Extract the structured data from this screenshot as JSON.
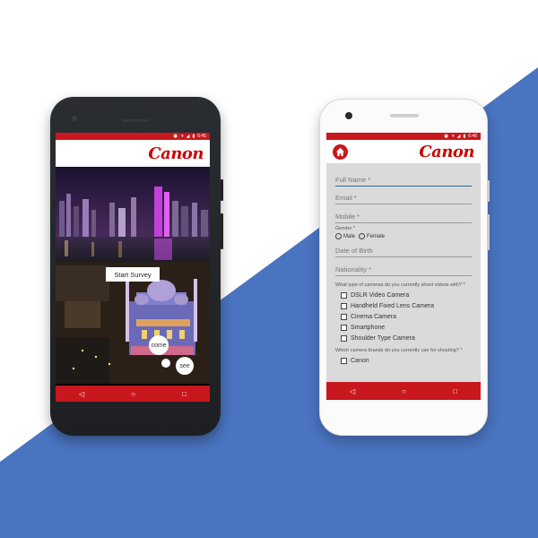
{
  "colors": {
    "brand_red": "#c8171d",
    "background_blue": "#4a74c0",
    "canon_red": "#cc0000"
  },
  "left_phone": {
    "status_time": "6:45",
    "logo": "Canon",
    "start_button": "Start Survey",
    "bubbles": {
      "come": "come",
      "see": "see"
    },
    "nav": {
      "back": "◁",
      "home": "○",
      "recents": "□"
    }
  },
  "right_phone": {
    "status_time": "6:46",
    "logo": "Canon",
    "home_icon": "home-icon",
    "fields": {
      "full_name": "Full Name *",
      "email": "Email *",
      "mobile": "Mobile *",
      "date_of_birth": "Date of Birth",
      "nationality": "Nationality *"
    },
    "gender": {
      "label": "Gender *",
      "options": [
        "Male",
        "Female"
      ]
    },
    "question_cameras": "What type of cameras do you currently shoot videos with? *",
    "camera_types": [
      "DSLR Video Camera",
      "Handheld Fixed Lens Camera",
      "Cinema Camera",
      "Smartphone",
      "Shoulder Type Camera"
    ],
    "question_brands": "Which camera brands do you currently use for shooting? *",
    "brands": [
      "Canon"
    ],
    "nav": {
      "back": "◁",
      "home": "○",
      "recents": "□"
    }
  }
}
